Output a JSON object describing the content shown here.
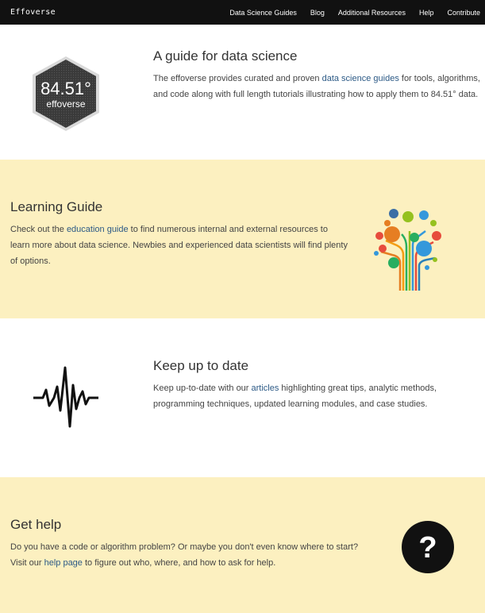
{
  "navbar": {
    "brand": "Effoverse",
    "links": [
      "Data Science Guides",
      "Blog",
      "Additional Resources",
      "Help",
      "Contribute"
    ]
  },
  "logo": {
    "line1": "84.51°",
    "line2": "effoverse"
  },
  "guide": {
    "title": "A guide for data science",
    "text_before": "The effoverse provides curated and proven ",
    "link": "data science guides",
    "text_after": " for tools, algorithms, and code along with full length tutorials illustrating how to apply them to 84.51° data."
  },
  "learning": {
    "title": "Learning Guide",
    "text_before": "Check out the ",
    "link": "education guide",
    "text_after": " to find numerous internal and external resources to learn more about data science. Newbies and experienced data scientists will find plenty of options."
  },
  "update": {
    "title": "Keep up to date",
    "text_before": "Keep up-to-date with our ",
    "link": "articles",
    "text_after": " highlighting great tips, analytic methods, programming techniques, updated learning modules, and case studies."
  },
  "help": {
    "title": "Get help",
    "text_before": "Do you have a code or algorithm problem? Or maybe you don't even know where to start? Visit our ",
    "link": "help page",
    "text_after": " to figure out who, where, and how to ask for help.",
    "icon_glyph": "?"
  },
  "icons": {
    "logo": "effoverse-hexagon-logo",
    "learning": "knowledge-tree-icon",
    "update": "pulse-waveform-icon",
    "help": "question-circle-icon"
  },
  "colors": {
    "navbar": "#111111",
    "section_highlight": "#fcf0c0",
    "link": "#2c5a86"
  }
}
